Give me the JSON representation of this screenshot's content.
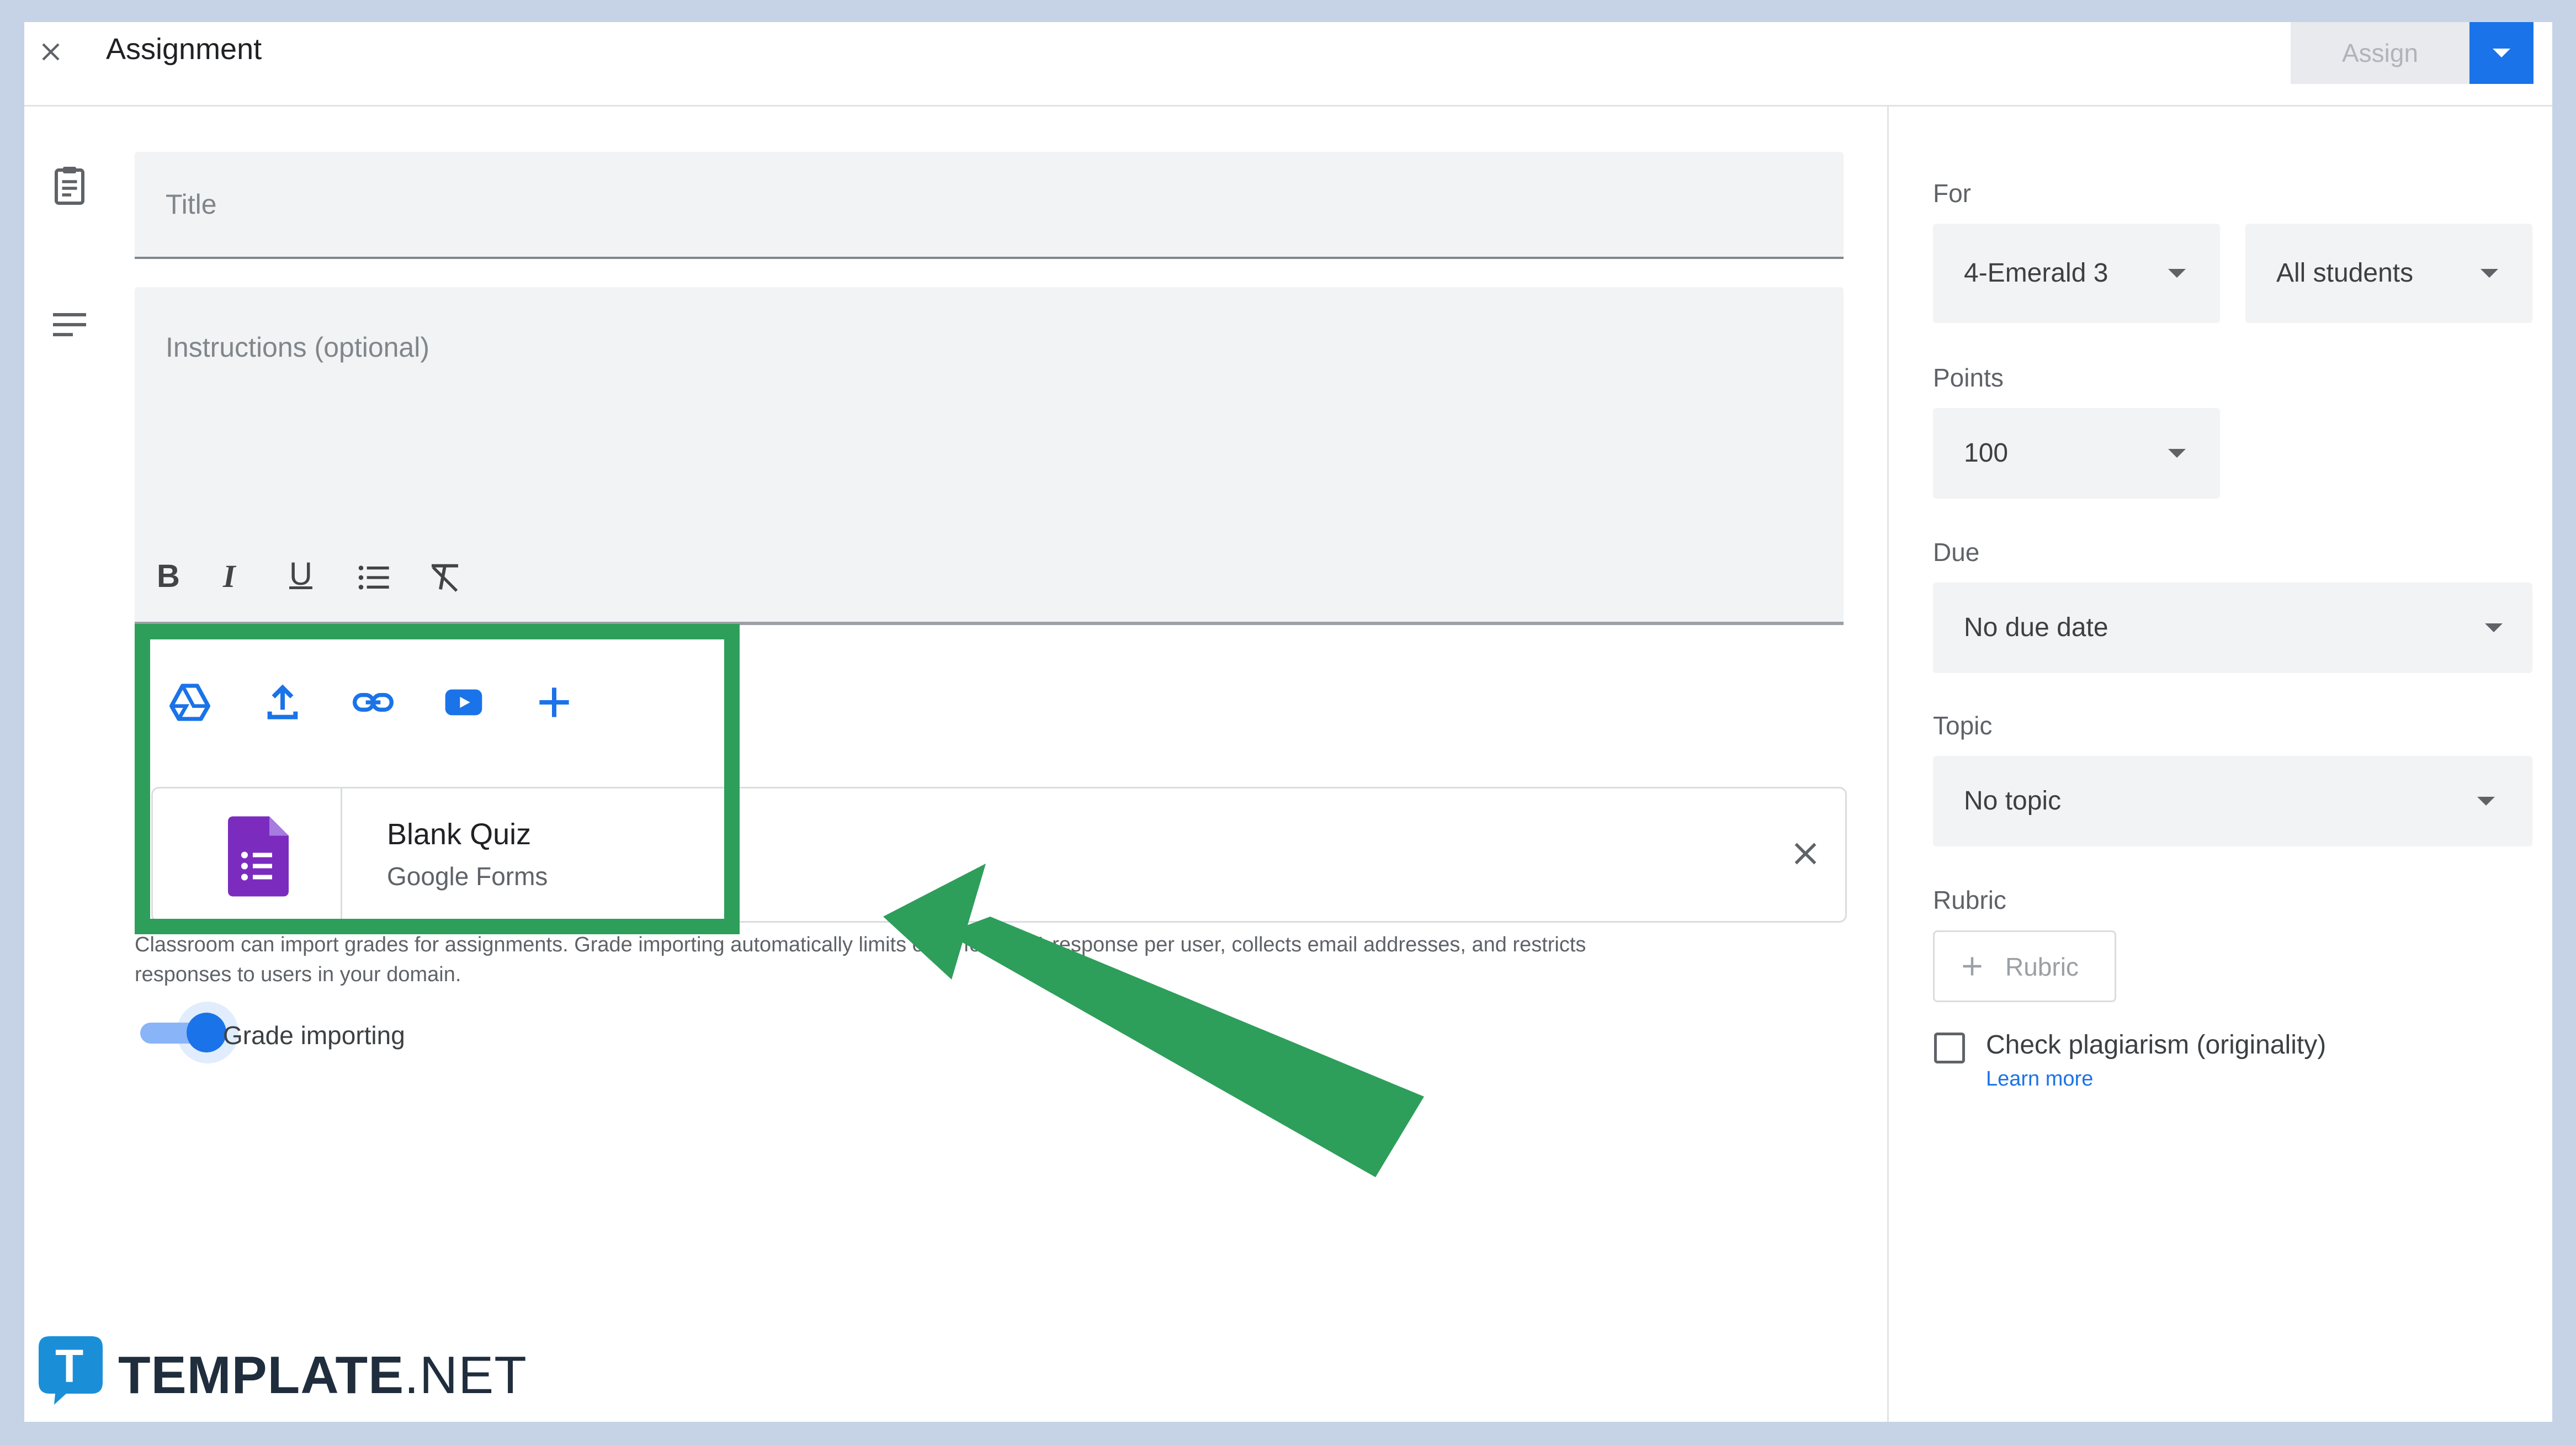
{
  "header": {
    "title": "Assignment",
    "assign_label": "Assign"
  },
  "editor": {
    "title_placeholder": "Title",
    "instructions_placeholder": "Instructions (optional)",
    "toolbar": [
      "bold-icon",
      "italic-icon",
      "underline-icon",
      "bulleted-list-icon",
      "clear-formatting-icon"
    ]
  },
  "attach": {
    "icons": [
      "google-drive-icon",
      "upload-icon",
      "link-icon",
      "youtube-icon",
      "add-icon"
    ],
    "item": {
      "title": "Blank Quiz",
      "subtitle": "Google Forms"
    },
    "notice_line1": "Classroom can import grades for assignments. Grade importing automatically limits each form to 1 response per user, collects email addresses, and restricts",
    "notice_line2": "responses to users in your domain.",
    "toggle_label": "Grade importing",
    "toggle_on": true
  },
  "sidebar": {
    "for_label": "For",
    "class_value": "4-Emerald 3",
    "students_value": "All students",
    "points_label": "Points",
    "points_value": "100",
    "due_label": "Due",
    "due_value": "No due date",
    "topic_label": "Topic",
    "topic_value": "No topic",
    "rubric_label": "Rubric",
    "rubric_button": "Rubric",
    "plagiarism_label": "Check plagiarism (originality)",
    "learn_more": "Learn more"
  },
  "watermark": {
    "brand_bold": "TEMPLATE",
    "brand_light": ".NET",
    "logo_letter": "T"
  },
  "colors": {
    "accent_blue": "#1a73e8",
    "highlight_green": "#2e9e5b",
    "forms_purple": "#7b2cbf",
    "assign_disabled_bg": "#e8eaed"
  }
}
